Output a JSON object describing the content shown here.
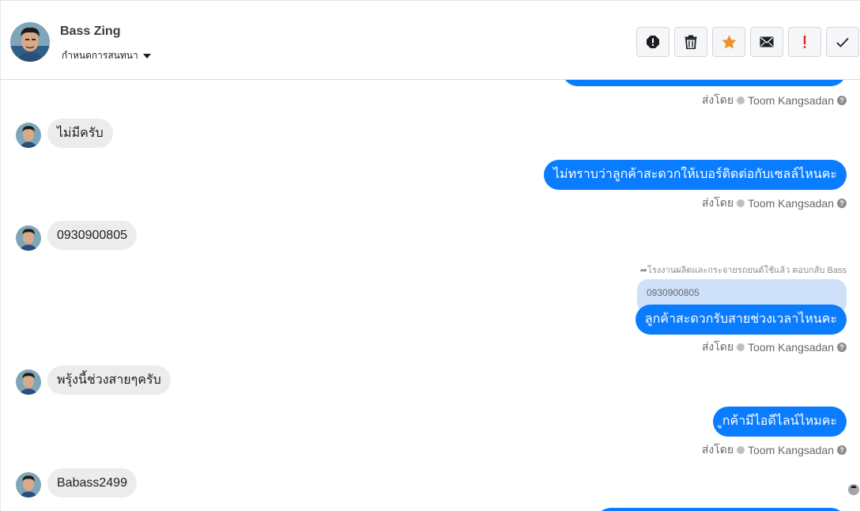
{
  "contact": {
    "name": "Bass Zing",
    "subtitle": "กำหนดการสนทนา"
  },
  "toolbar": {
    "buttons": [
      {
        "name": "alert-icon",
        "color": "#1c1e21"
      },
      {
        "name": "trash-icon",
        "color": "#1c1e21"
      },
      {
        "name": "star-icon",
        "color": "#f0902b"
      },
      {
        "name": "envelope-icon",
        "color": "#1c1e21"
      },
      {
        "name": "exclamation-icon",
        "color": "#e02424"
      },
      {
        "name": "checkmark-icon",
        "color": "#1c1e21"
      }
    ]
  },
  "messages": {
    "sent_by_prefix": "ส่งโดย",
    "agent": "Toom Kangsadan",
    "incoming": [
      {
        "text": "ไม่มีครับ"
      },
      {
        "text": "0930900805"
      },
      {
        "text": "พรุ้งนี้ช่วงสายๆครับ"
      },
      {
        "text": "Babass2499"
      }
    ],
    "outgoing": [
      {
        "text": "ไม่ทราบว่าลูกค้าสะดวกให้เบอร์ติดต่อกับเซลล์ไหนคะ"
      },
      {
        "text": "ลูกค้าสะดวกรับสายช่วงเวลาไหนคะ"
      },
      {
        "text": "ูกค้ามีไอดีไลน์ไหมคะ"
      }
    ],
    "reply_meta": "โรงงานผลิตและกระจายรถยนต์ใช้แล้ว ตอบกลับ Bass",
    "quoted_text": "0930900805"
  },
  "colors": {
    "outgoing_bubble": "#0a7cff",
    "incoming_bubble": "#ececec",
    "quoted_bubble": "#cfe1f9"
  }
}
